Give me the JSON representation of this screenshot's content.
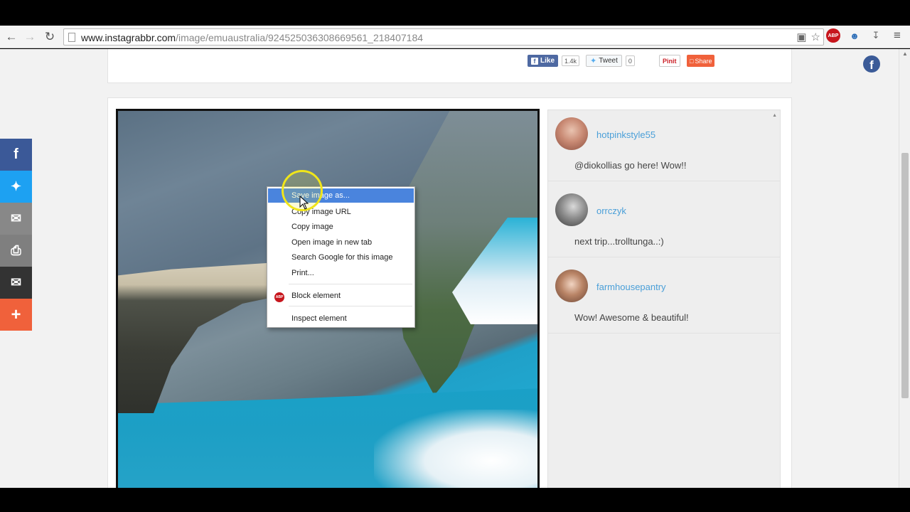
{
  "browser": {
    "url_host": "www.instagrabbr.com",
    "url_path": "/image/emuaustralia/924525036308669561_218407184"
  },
  "share_top": {
    "like_label": "Like",
    "like_count": "1.4k",
    "tweet_label": "Tweet",
    "tweet_count": "0",
    "pin_label": "Pinit",
    "share_label": "Share"
  },
  "context_menu": {
    "items": [
      "Save image as...",
      "Copy image URL",
      "Copy image",
      "Open image in new tab",
      "Search Google for this image",
      "Print...",
      "Block element",
      "Inspect element"
    ],
    "highlighted_index": 0
  },
  "comments": [
    {
      "username": "hotpinkstyle55",
      "text": "@diokollias go here! Wow!!"
    },
    {
      "username": "orrczyk",
      "text": "next trip...trolltunga..:)"
    },
    {
      "username": "farmhousepantry",
      "text": "Wow! Awesome & beautiful!"
    }
  ],
  "social_bar": {
    "colors": [
      "#3b5998",
      "#1da1f2",
      "#888888",
      "#7f7f7f",
      "#333333",
      "#f0613b"
    ],
    "icons": [
      "facebook-icon",
      "twitter-icon",
      "email-icon",
      "print-icon",
      "gmail-icon",
      "plus-icon"
    ]
  }
}
